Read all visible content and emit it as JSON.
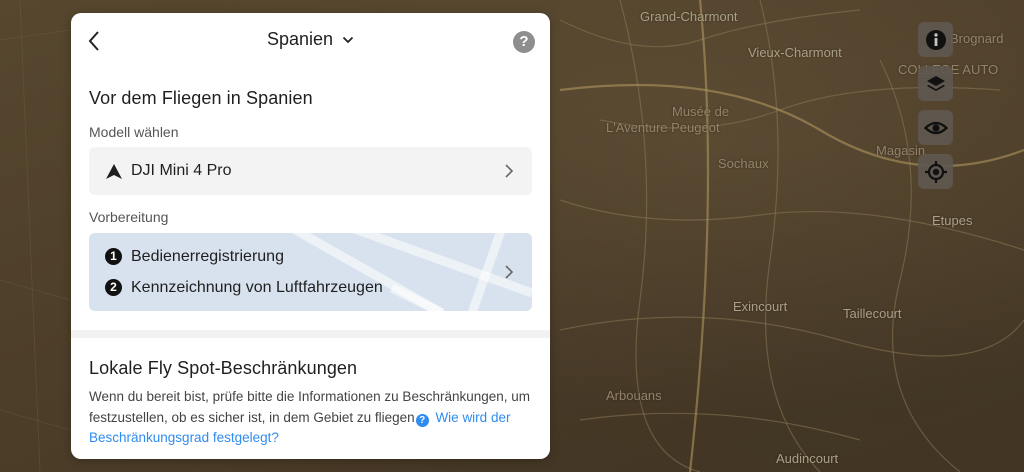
{
  "map": {
    "places": [
      "Grand-Charmont",
      "Vieux-Charmont",
      "COLLEGE AUTO",
      "Musée de",
      "L'Aventure Peugeot",
      "Sochaux",
      "Brognard",
      "Magasin",
      "Etupes",
      "Exincourt",
      "Taillecourt",
      "Audincourt",
      "Arbouans"
    ]
  },
  "controls": {
    "info_icon": "info-icon",
    "layers_icon": "layers-icon",
    "visibility_icon": "eye-icon",
    "locate_icon": "locate-icon"
  },
  "header": {
    "country": "Spanien"
  },
  "before_flight": {
    "title": "Vor dem Fliegen in Spanien",
    "model_label": "Modell wählen",
    "model_value": "DJI Mini 4 Pro",
    "prep_label": "Vorbereitung",
    "steps": [
      {
        "number": "1",
        "label": "Bedienerregistrierung"
      },
      {
        "number": "2",
        "label": "Kennzeichnung von Luftfahrzeugen"
      }
    ]
  },
  "local_restrictions": {
    "title": "Lokale Fly Spot-Beschränkungen",
    "description": "Wenn du bereit bist, prüfe bitte die Informationen zu Beschränkungen, um festzustellen, ob es sicher ist, in dem Gebiet zu fliegen",
    "help_glyph": "?",
    "link_text": "Wie wird der Beschränkungsgrad festgelegt?"
  },
  "colors": {
    "accent": "#2f8cf0",
    "prep_card": "#d8e2ee",
    "map_base": "#4d3e29"
  }
}
